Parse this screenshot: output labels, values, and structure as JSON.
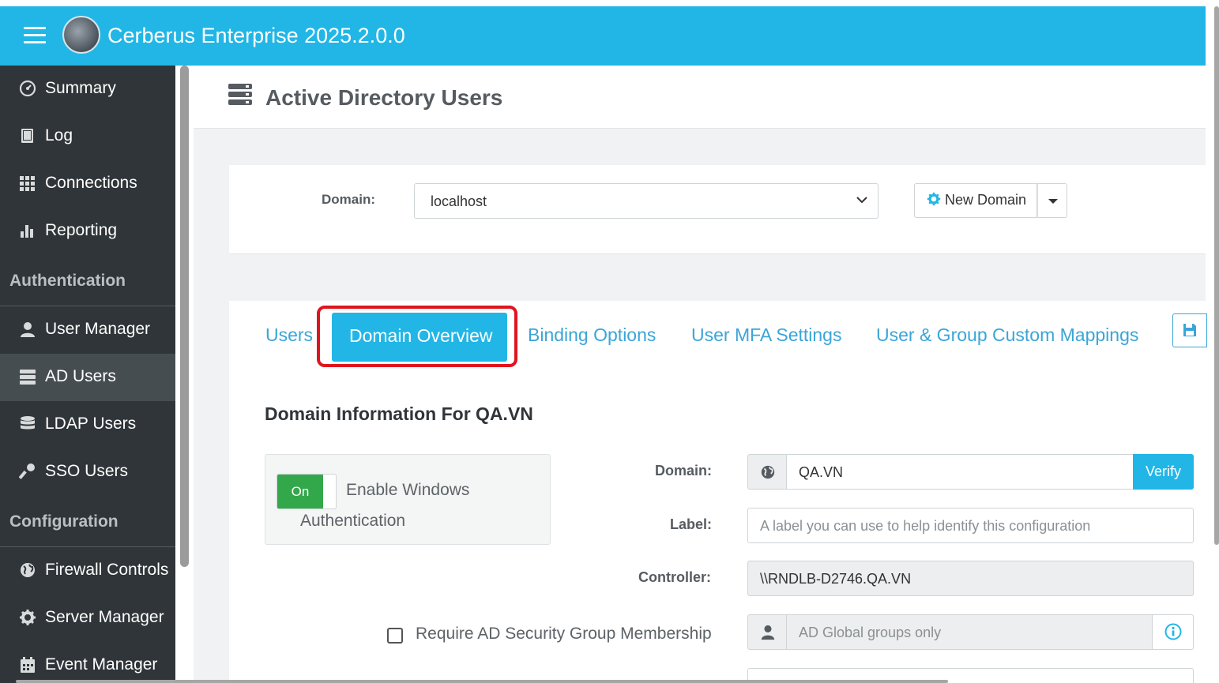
{
  "app": {
    "title": "Cerberus Enterprise 2025.2.0.0"
  },
  "sidebar": {
    "items": [
      {
        "label": "Summary",
        "icon": "dashboard-icon"
      },
      {
        "label": "Log",
        "icon": "book-icon"
      },
      {
        "label": "Connections",
        "icon": "grid-icon"
      },
      {
        "label": "Reporting",
        "icon": "bar-chart-icon"
      }
    ],
    "sections": {
      "authentication": "Authentication",
      "configuration": "Configuration"
    },
    "auth_items": [
      {
        "label": "User Manager",
        "icon": "user-icon"
      },
      {
        "label": "AD Users",
        "icon": "server-icon",
        "active": true
      },
      {
        "label": "LDAP Users",
        "icon": "database-icon"
      },
      {
        "label": "SSO Users",
        "icon": "key-icon"
      }
    ],
    "config_items": [
      {
        "label": "Firewall Controls",
        "icon": "globe-icon"
      },
      {
        "label": "Server Manager",
        "icon": "gear-icon"
      },
      {
        "label": "Event Manager",
        "icon": "calendar-icon"
      }
    ]
  },
  "page": {
    "title": "Active Directory Users",
    "icon": "server-icon"
  },
  "domain_bar": {
    "label": "Domain:",
    "selected": "localhost",
    "new_domain_label": "New Domain"
  },
  "tabs": [
    {
      "label": "Users"
    },
    {
      "label": "Domain Overview",
      "active": true
    },
    {
      "label": "Binding Options"
    },
    {
      "label": "User MFA Settings"
    },
    {
      "label": "User & Group Custom Mappings"
    }
  ],
  "section": {
    "title": "Domain Information For QA.VN"
  },
  "windows_auth": {
    "toggle_label": "On",
    "line1": "Enable Windows",
    "line2": "Authentication"
  },
  "form": {
    "domain_label": "Domain:",
    "domain_value": "QA.VN",
    "verify_label": "Verify",
    "label_label": "Label:",
    "label_placeholder": "A label you can use to help identify this configuration",
    "controller_label": "Controller:",
    "controller_value": "\\\\RNDLB-D2746.QA.VN",
    "require_group_label": "Require AD Security Group Membership",
    "group_placeholder": "AD Global groups only"
  },
  "colors": {
    "header": "#21b6e6",
    "sidebar": "#2f3538",
    "sidebar_active": "#464d51",
    "tab_link": "#3aa5d8",
    "toggle_on": "#33a84a",
    "highlight": "#e0141e"
  }
}
